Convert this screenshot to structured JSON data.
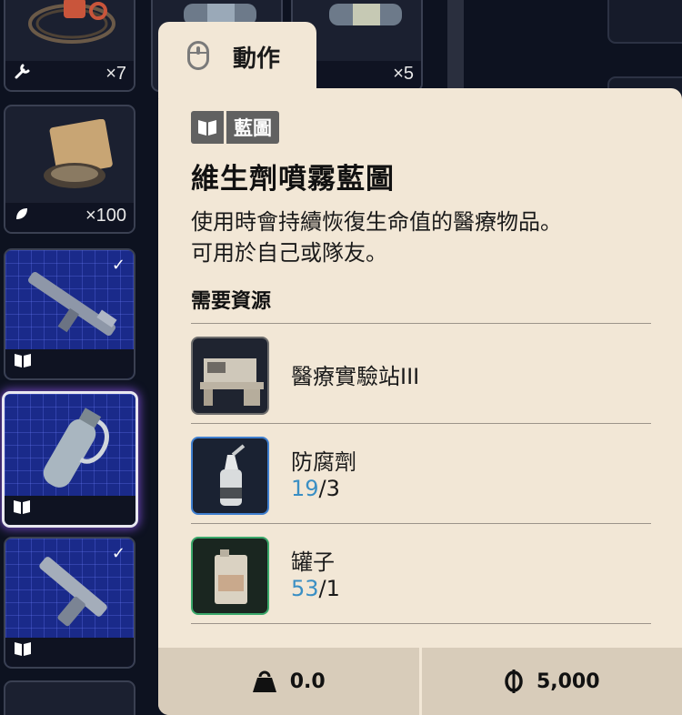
{
  "inventory": {
    "slots": [
      {
        "id": "wire-coil",
        "quantity": "×7",
        "footer_icon": "wrench-icon",
        "checked": false
      },
      {
        "id": "canister-a",
        "quantity": "",
        "footer_icon": "",
        "checked": false
      },
      {
        "id": "canister-b",
        "quantity": "×5",
        "footer_icon": "",
        "checked": false
      },
      {
        "id": "seed-packet",
        "quantity": "×100",
        "footer_icon": "leaf-icon",
        "checked": false
      },
      {
        "id": "rifle-blueprint",
        "quantity": "",
        "footer_icon": "book-icon",
        "checked": true
      },
      {
        "id": "spray-blueprint",
        "quantity": "",
        "footer_icon": "book-icon",
        "checked": false,
        "selected": true
      },
      {
        "id": "pistol-blueprint",
        "quantity": "",
        "footer_icon": "book-icon",
        "checked": true
      }
    ]
  },
  "tooltip": {
    "tab_label": "動作",
    "tab_icon": "mouse-icon",
    "badge_label": "藍圖",
    "badge_icon": "book-icon",
    "title": "維生劑噴霧藍圖",
    "description_line1": "使用時會持續恢復生命值的醫療物品。",
    "description_line2": "可用於自己或隊友。",
    "requirements_heading": "需要資源",
    "requirements": [
      {
        "name": "醫療實驗站III",
        "have": "",
        "need": "",
        "frame": "gray",
        "icon": "lab-station-icon"
      },
      {
        "name": "防腐劑",
        "have": "19",
        "need": "/3",
        "frame": "blue",
        "icon": "bottle-icon"
      },
      {
        "name": "罐子",
        "have": "53",
        "need": "/1",
        "frame": "green",
        "icon": "can-icon"
      }
    ],
    "weight_icon": "weight-icon",
    "weight": "0.0",
    "price_icon": "coin-icon",
    "price": "5,000"
  },
  "colors": {
    "tooltip_bg": "#f2e7d6",
    "footer_bg": "#d8ccba",
    "have_count": "#3a8fc4",
    "blueprint_bg": "#1a2a8a",
    "badge_bg": "#616161"
  }
}
